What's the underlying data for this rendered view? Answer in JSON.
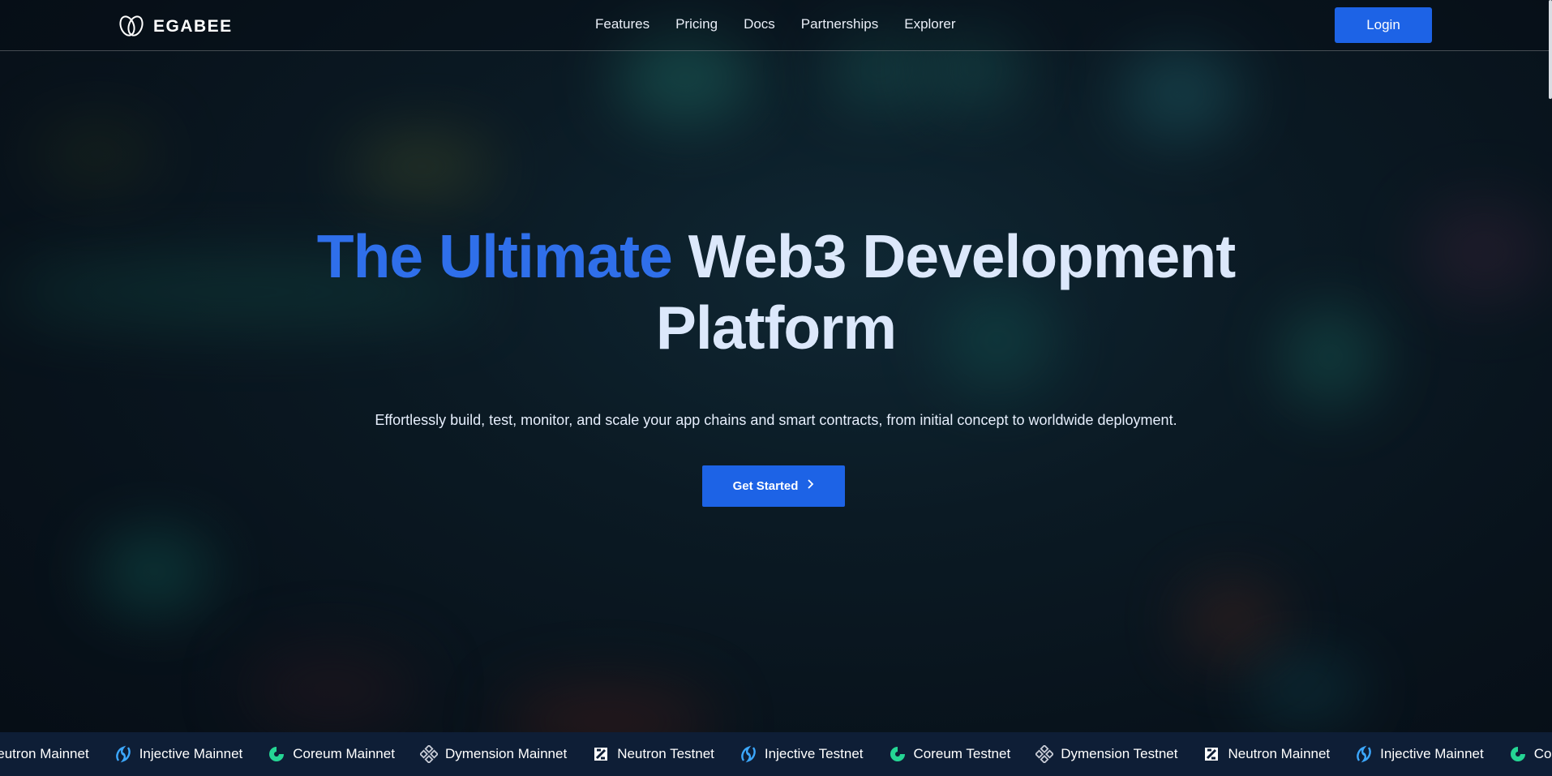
{
  "brand": {
    "name": "EGABEE"
  },
  "nav": {
    "items": [
      {
        "label": "Features"
      },
      {
        "label": "Pricing"
      },
      {
        "label": "Docs"
      },
      {
        "label": "Partnerships"
      },
      {
        "label": "Explorer"
      }
    ]
  },
  "header": {
    "login_label": "Login"
  },
  "hero": {
    "title_accent": "The Ultimate",
    "title_rest_line1": "Web3 Development",
    "title_line2": "Platform",
    "subtitle": "Effortlessly build, test, monitor, and scale your app chains and smart contracts, from initial concept to worldwide deployment.",
    "cta_label": "Get Started"
  },
  "ticker": {
    "chains": [
      {
        "label": "Neutron Mainnet",
        "icon": "neutron-icon"
      },
      {
        "label": "Injective Mainnet",
        "icon": "injective-icon"
      },
      {
        "label": "Coreum Mainnet",
        "icon": "coreum-icon"
      },
      {
        "label": "Dymension Mainnet",
        "icon": "dymension-icon"
      },
      {
        "label": "Neutron Testnet",
        "icon": "neutron-icon"
      },
      {
        "label": "Injective Testnet",
        "icon": "injective-icon"
      },
      {
        "label": "Coreum Testnet",
        "icon": "coreum-icon"
      },
      {
        "label": "Dymension Testnet",
        "icon": "dymension-icon"
      },
      {
        "label": "Neutron Mainnet",
        "icon": "neutron-icon"
      },
      {
        "label": "Injective Mainnet",
        "icon": "injective-icon"
      },
      {
        "label": "Coreum Mainnet",
        "icon": "coreum-icon"
      }
    ]
  },
  "colors": {
    "accent": "#1d63e6",
    "title_accent": "#2f6fea",
    "title_light": "#dce8fb",
    "ticker_bg": "#0e1e36"
  }
}
